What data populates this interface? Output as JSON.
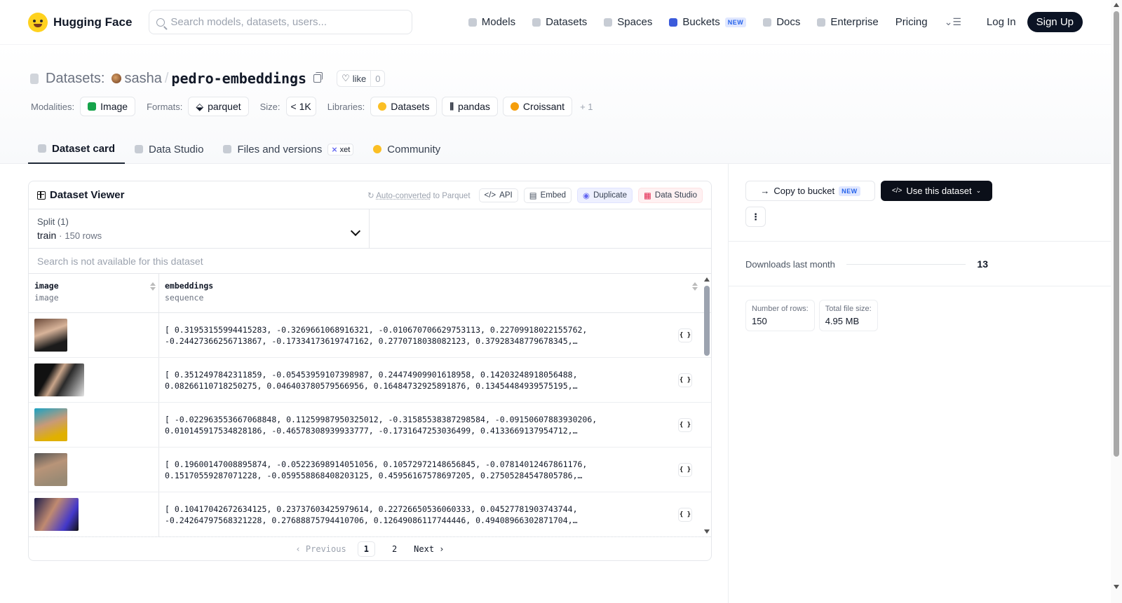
{
  "nav": {
    "brand": "Hugging Face",
    "search_placeholder": "Search models, datasets, users...",
    "links": [
      "Models",
      "Datasets",
      "Spaces",
      "Buckets",
      "Docs",
      "Enterprise",
      "Pricing"
    ],
    "new_badge": "NEW",
    "login": "Log In",
    "signup": "Sign Up"
  },
  "repo": {
    "crumb": "Datasets:",
    "owner": "sasha",
    "name": "pedro-embeddings",
    "like_label": "like",
    "like_count": "0"
  },
  "tags": {
    "modalities_label": "Modalities:",
    "modality": "Image",
    "formats_label": "Formats:",
    "format": "parquet",
    "size_label": "Size:",
    "size": "< 1K",
    "libraries_label": "Libraries:",
    "libraries": [
      "Datasets",
      "pandas",
      "Croissant"
    ],
    "more": "+ 1"
  },
  "tabs": [
    "Dataset card",
    "Data Studio",
    "Files and versions",
    "Community"
  ],
  "xet_badge": "xet",
  "viewer": {
    "title": "Dataset Viewer",
    "autoconverted": "Auto-converted",
    "to_parquet": " to Parquet",
    "actions": [
      "API",
      "Embed",
      "Duplicate",
      "Data Studio"
    ],
    "split_label": "Split (1)",
    "split_name": "train",
    "split_rows": "150 rows",
    "search_na": "Search is not available for this dataset",
    "columns": [
      {
        "name": "image",
        "type": "image"
      },
      {
        "name": "embeddings",
        "type": "sequence"
      }
    ],
    "rows": [
      {
        "line1": "[ 0.31953155994415283, -0.3269661068916321, -0.010670706629753113, 0.22709918022155762,",
        "line2": "-0.24427366256713867, -0.17334173619747162, 0.2770718038082123, 0.37928348779678345,…"
      },
      {
        "line1": "[ 0.3512497842311859, -0.05453959107398987, 0.24474909901618958, 0.14203248918056488,",
        "line2": "0.08266110718250275, 0.046403780579566956, 0.16484732925891876, 0.13454484939575195,…"
      },
      {
        "line1": "[ -0.022963553667068848, 0.11259987950325012, -0.31585538387298584, -0.09150607883930206,",
        "line2": "0.010145917534828186, -0.46578308939933777, -0.1731647253036499, 0.4133669137954712,…"
      },
      {
        "line1": "[ 0.19600147008895874, -0.05223698914051056, 0.10572972148656845, -0.07814012467861176,",
        "line2": "0.15170559287071228, -0.059558868408203125, 0.45956167578697205, 0.27505284547805786,…"
      },
      {
        "line1": "[ 0.10417042672634125, 0.23737603425979614, 0.22726650536060333, 0.04527781903743744,",
        "line2": "-0.24264797568321228, 0.27688875794410706, 0.12649086117744446, 0.49408966302871704,…"
      }
    ],
    "json_icon": "{ }",
    "pager": {
      "prev": "Previous",
      "pages": [
        "1",
        "2"
      ],
      "next": "Next"
    }
  },
  "sidebar": {
    "copy_bucket": "Copy to bucket",
    "use_dataset": "Use this dataset",
    "downloads_label": "Downloads last month",
    "downloads": "13",
    "rows_label": "Number of rows:",
    "rows": "150",
    "size_label": "Total file size:",
    "size": "4.95 MB"
  }
}
